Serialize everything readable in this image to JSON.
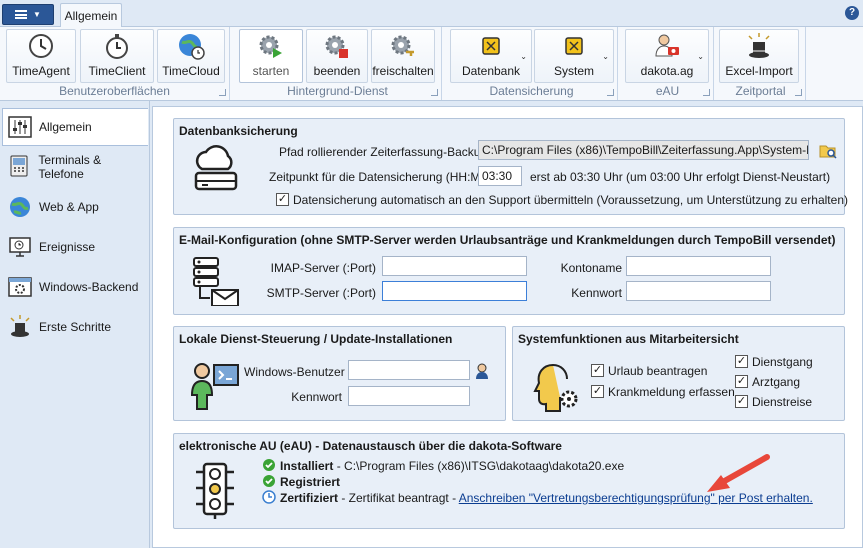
{
  "tabs": {
    "allgemein": "Allgemein"
  },
  "ribbon": {
    "groups": {
      "benutzer": "Benutzeroberflächen",
      "dienst": "Hintergrund-Dienst",
      "sicherung": "Datensicherung",
      "eau": "eAU",
      "portal": "Zeitportal"
    },
    "buttons": {
      "timeagent": "TimeAgent",
      "timeclient": "TimeClient",
      "timecloud": "TimeCloud",
      "starten": "starten",
      "beenden": "beenden",
      "freischalten": "freischalten",
      "datenbank": "Datenbank",
      "system": "System",
      "dakota": "dakota.ag",
      "excel": "Excel-Import"
    }
  },
  "sidebar": {
    "items": [
      {
        "label": "Allgemein"
      },
      {
        "label": "Terminals & Telefone"
      },
      {
        "label": "Web & App"
      },
      {
        "label": "Ereignisse"
      },
      {
        "label": "Windows-Backend"
      },
      {
        "label": "Erste Schritte"
      }
    ]
  },
  "backup": {
    "title": "Datenbanksicherung",
    "path_label": "Pfad rollierender Zeiterfassung-Backups",
    "path_value": "C:\\Program Files (x86)\\TempoBill\\Zeiterfassung.App\\System-Recove",
    "time_label": "Zeitpunkt für die Datensicherung (HH:MM)",
    "time_value": "03:30",
    "time_note": "erst ab 03:30 Uhr (um 03:00 Uhr erfolgt Dienst-Neustart)",
    "auto_label": "Datensicherung automatisch an den Support übermitteln (Voraussetzung, um Unterstützung zu erhalten)",
    "auto_checked": true
  },
  "email": {
    "title": "E-Mail-Konfiguration (ohne SMTP-Server werden Urlaubsanträge und Krankmeldungen durch TempoBill versendet)",
    "imap_label": "IMAP-Server (:Port)",
    "smtp_label": "SMTP-Server (:Port)",
    "konto_label": "Kontoname",
    "kennwort_label": "Kennwort",
    "imap_value": "",
    "smtp_value": "",
    "konto_value": "",
    "kennwort_value": ""
  },
  "service": {
    "title": "Lokale Dienst-Steuerung / Update-Installationen",
    "user_label": "Windows-Benutzer",
    "pass_label": "Kennwort",
    "user_value": "",
    "pass_value": ""
  },
  "sysfunc": {
    "title": "Systemfunktionen aus Mitarbeitersicht",
    "items": [
      {
        "label": "Urlaub beantragen",
        "checked": true
      },
      {
        "label": "Krankmeldung erfassen",
        "checked": true
      },
      {
        "label": "Dienstgang",
        "checked": true
      },
      {
        "label": "Arztgang",
        "checked": true
      },
      {
        "label": "Dienstreise",
        "checked": true
      }
    ]
  },
  "eau": {
    "title": "elektronische AU (eAU) - Datenaustausch über die dakota-Software",
    "installed_bold": "Installiert",
    "installed_rest": " - C:\\Program Files (x86)\\ITSG\\dakotaag\\dakota20.exe",
    "registered_bold": "Registriert",
    "certified_bold": "Zertifiziert",
    "certified_rest": " - Zertifikat beantragt - ",
    "link": "Anschreiben \"Vertretungsberechtigungsprüfung\" per Post erhalten."
  },
  "colors": {
    "accent": "#2b5797",
    "arrow": "#e8473a",
    "check_green": "#3aa335",
    "clock_blue": "#3a7fd0"
  }
}
